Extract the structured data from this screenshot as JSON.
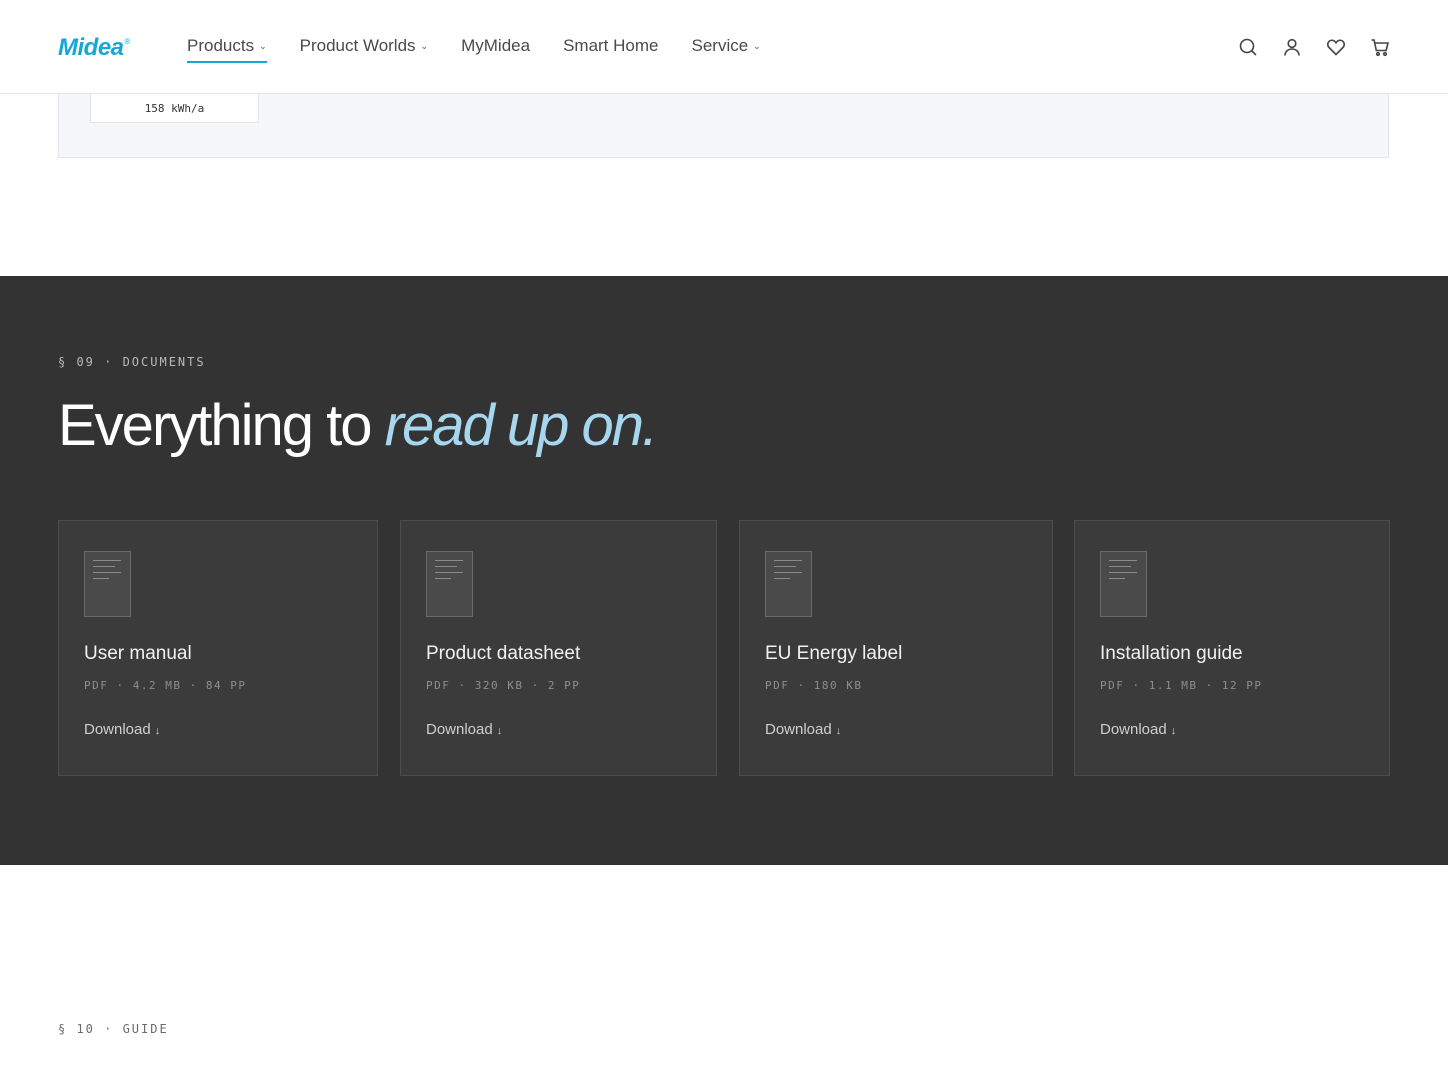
{
  "header": {
    "logo": "Midea",
    "logo_mark": "®",
    "nav": [
      {
        "label": "Products",
        "has_caret": true
      },
      {
        "label": "Product Worlds",
        "has_caret": true
      },
      {
        "label": "MyMidea",
        "has_caret": false
      },
      {
        "label": "Smart Home",
        "has_caret": false
      },
      {
        "label": "Service",
        "has_caret": true
      }
    ],
    "caret": "⌄",
    "icons": [
      "search-icon",
      "account-icon",
      "wishlist-heart-icon",
      "cart-icon"
    ],
    "accent_color": "#16a7d8"
  },
  "spec": {
    "value": "158 kWh/a"
  },
  "documents": {
    "eyebrow": "§ 09 · DOCUMENTS",
    "title_plain": "Everything to ",
    "title_accent": "read up on.",
    "accent_color": "#a7d7ee",
    "cards": [
      {
        "name": "User manual",
        "meta": "PDF · 4.2 MB · 84 PP",
        "download": "Download",
        "arrow": "↓"
      },
      {
        "name": "Product datasheet",
        "meta": "PDF · 320 KB · 2 PP",
        "download": "Download",
        "arrow": "↓"
      },
      {
        "name": "EU Energy label",
        "meta": "PDF · 180 KB",
        "download": "Download",
        "arrow": "↓"
      },
      {
        "name": "Installation guide",
        "meta": "PDF · 1.1 MB · 12 PP",
        "download": "Download",
        "arrow": "↓"
      }
    ]
  },
  "guide": {
    "eyebrow": "§ 10 · GUIDE"
  }
}
